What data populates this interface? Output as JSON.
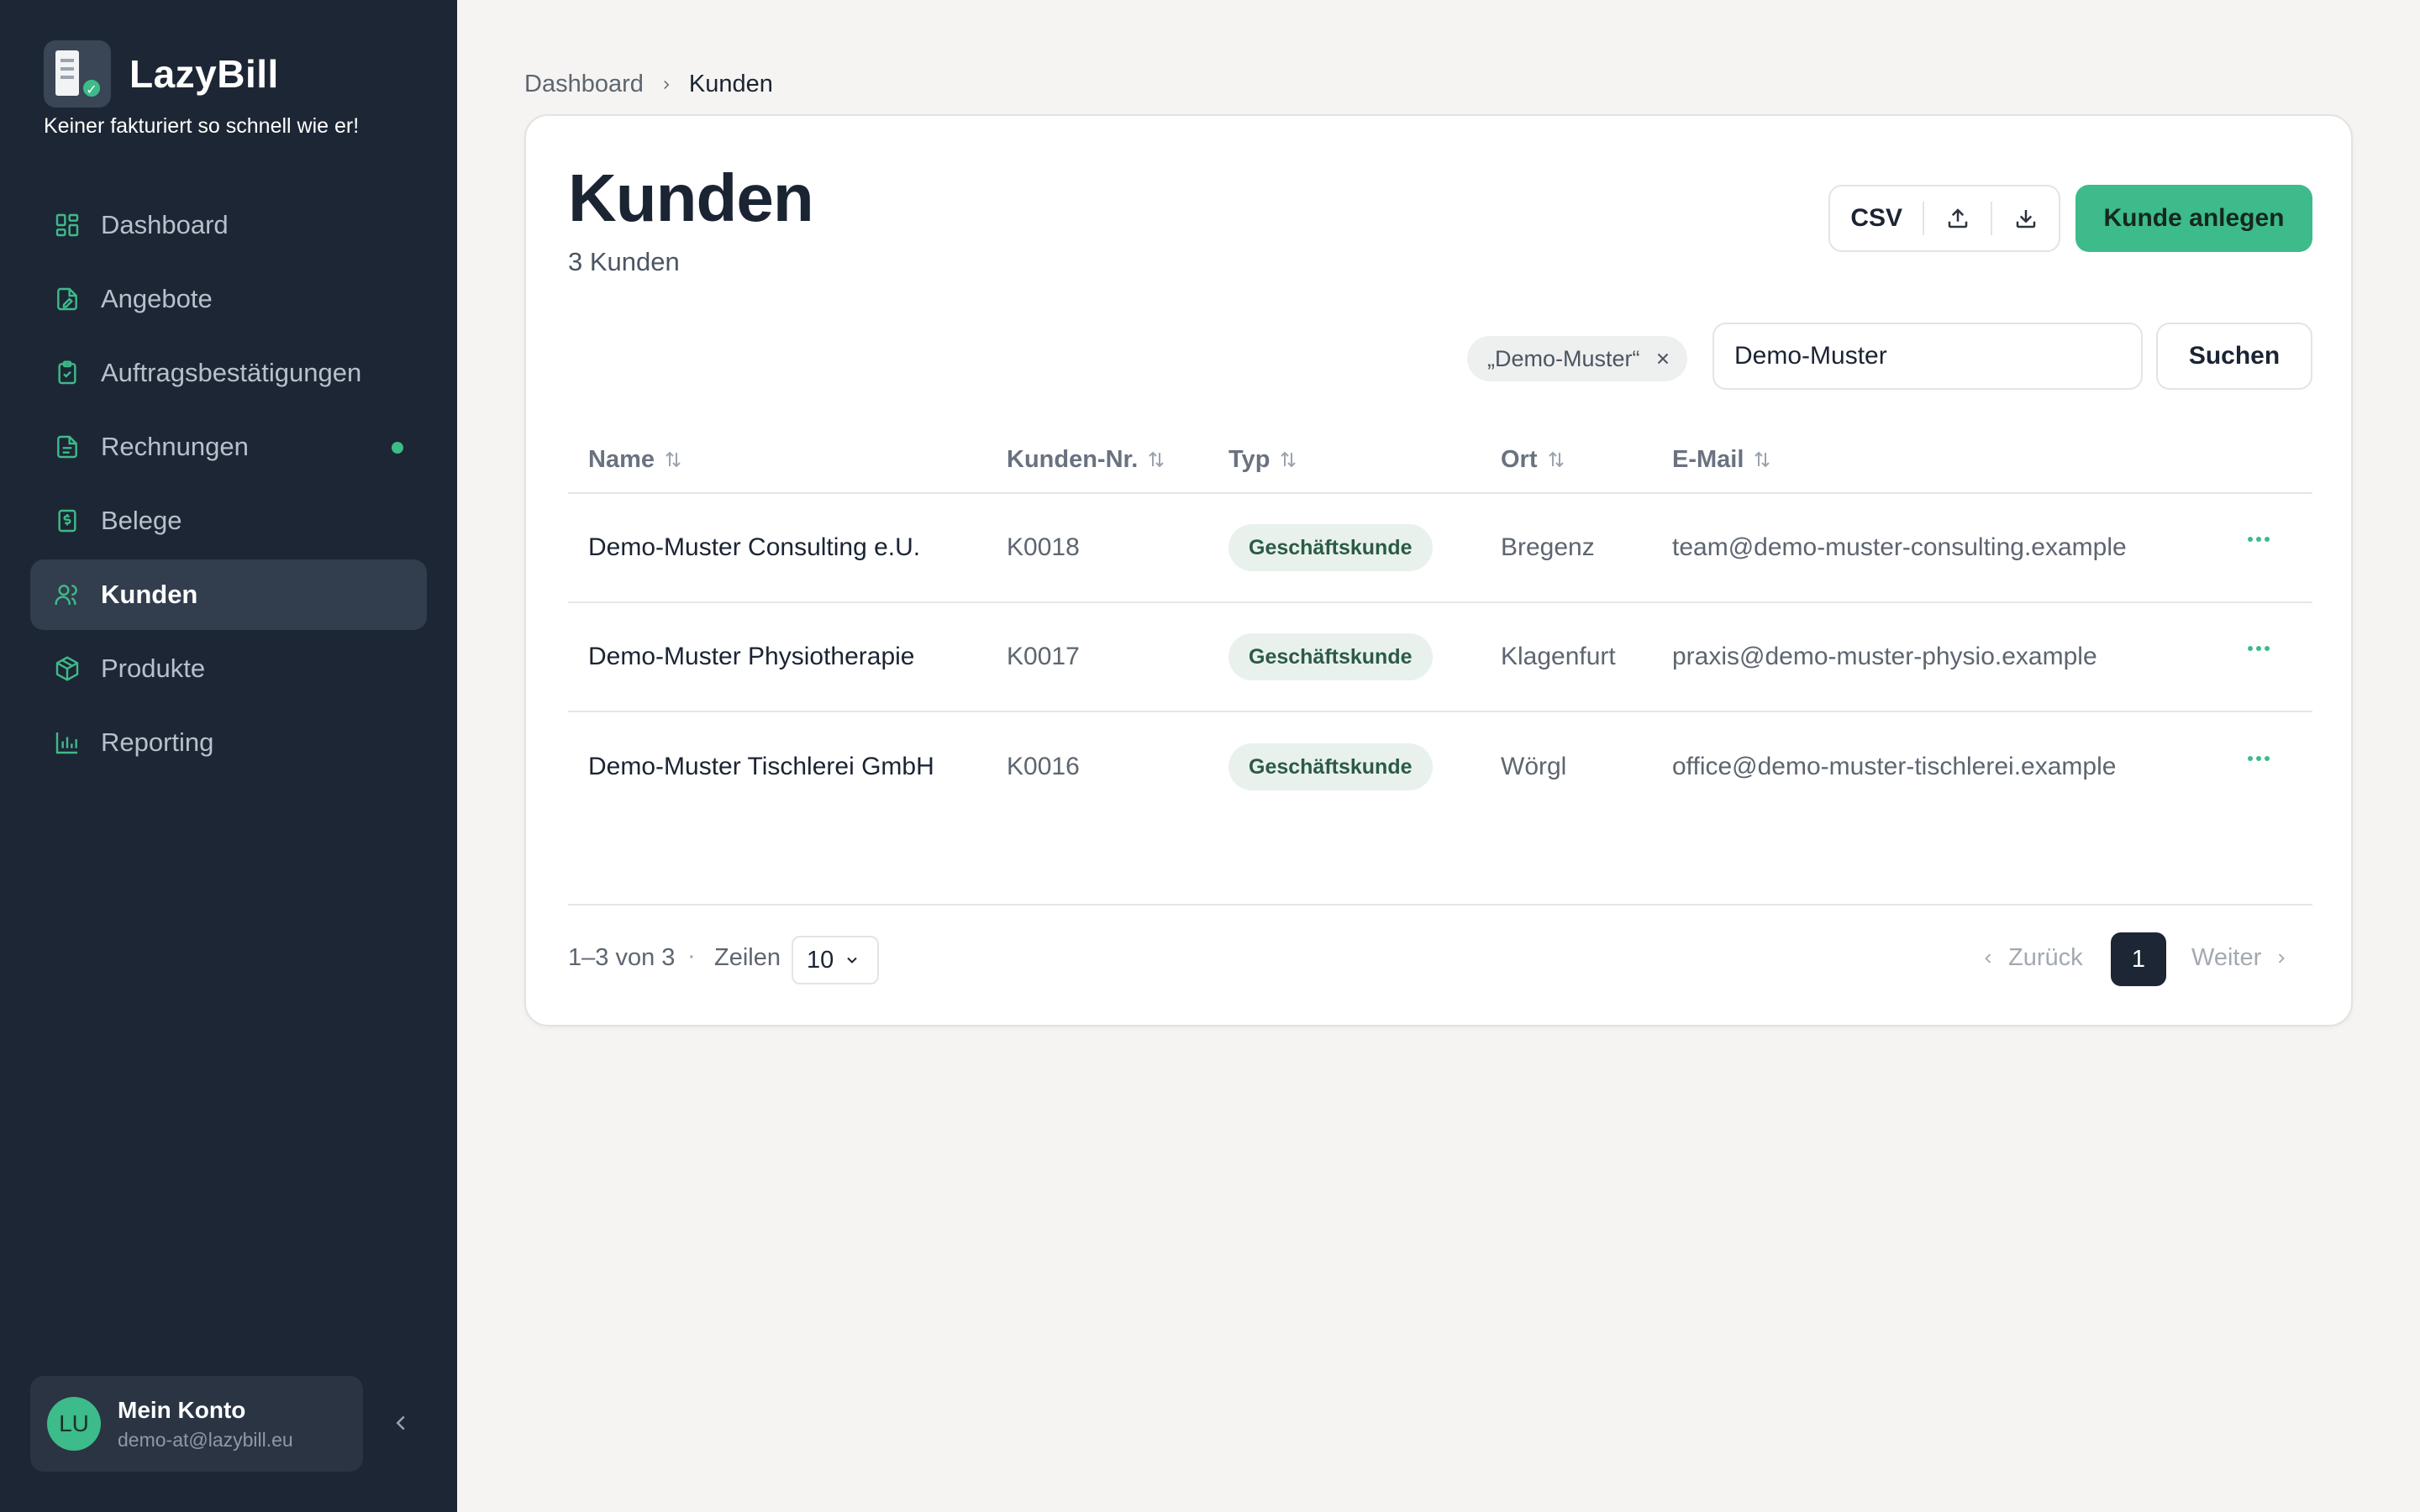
{
  "brand": {
    "name": "LazyBill",
    "tagline": "Keiner fakturiert so schnell wie er!"
  },
  "sidebar": {
    "items": [
      {
        "label": "Dashboard",
        "icon": "dashboard-icon"
      },
      {
        "label": "Angebote",
        "icon": "quote-document-icon"
      },
      {
        "label": "Auftragsbestätigungen",
        "icon": "clipboard-check-icon"
      },
      {
        "label": "Rechnungen",
        "icon": "invoice-icon",
        "notification_dot": true
      },
      {
        "label": "Belege",
        "icon": "receipt-icon"
      },
      {
        "label": "Kunden",
        "icon": "users-icon",
        "active": true
      },
      {
        "label": "Produkte",
        "icon": "package-icon"
      },
      {
        "label": "Reporting",
        "icon": "bar-chart-icon"
      }
    ],
    "accent_color": "#3dbb8a"
  },
  "account": {
    "initials": "LU",
    "name": "Mein Konto",
    "email": "demo-at@lazybill.eu"
  },
  "breadcrumb": {
    "parent": "Dashboard",
    "current": "Kunden"
  },
  "page": {
    "title": "Kunden",
    "subtitle": "3 Kunden",
    "csv_label": "CSV",
    "create_button": "Kunde anlegen"
  },
  "search": {
    "filter_chip": "„Demo-Muster“",
    "value": "Demo-Muster",
    "button": "Suchen"
  },
  "table": {
    "columns": [
      "Name",
      "Kunden-Nr.",
      "Typ",
      "Ort",
      "E-Mail"
    ],
    "rows": [
      {
        "name": "Demo-Muster Consulting e.U.",
        "number": "K0018",
        "type": "Geschäftskunde",
        "city": "Bregenz",
        "email": "team@demo-muster-consulting.example"
      },
      {
        "name": "Demo-Muster Physiotherapie",
        "number": "K0017",
        "type": "Geschäftskunde",
        "city": "Klagenfurt",
        "email": "praxis@demo-muster-physio.example"
      },
      {
        "name": "Demo-Muster Tischlerei GmbH",
        "number": "K0016",
        "type": "Geschäftskunde",
        "city": "Wörgl",
        "email": "office@demo-muster-tischlerei.example"
      }
    ]
  },
  "pagination": {
    "range": "1–3 von 3",
    "separator": "·",
    "rows_label": "Zeilen",
    "rows_per_page": "10",
    "prev": "Zurück",
    "current_page": "1",
    "next": "Weiter"
  }
}
